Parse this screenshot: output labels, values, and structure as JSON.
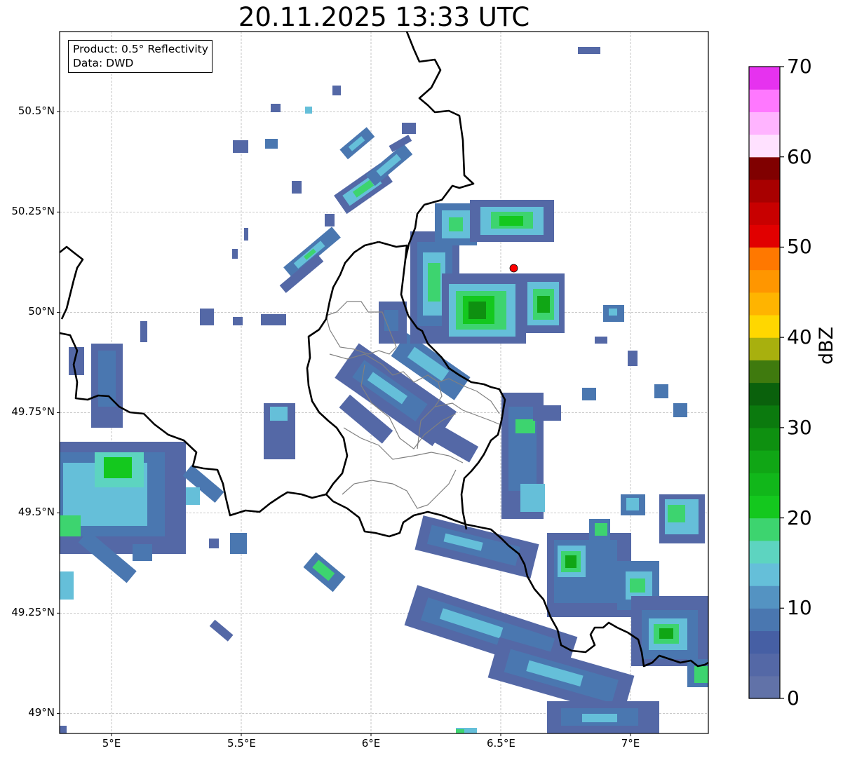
{
  "title": "20.11.2025 13:33 UTC",
  "info": {
    "product_label": "Product:",
    "product_value": "0.5° Reflectivity",
    "data_label": "Data:",
    "data_value": "DWD"
  },
  "map": {
    "lon_range": [
      4.8,
      7.3
    ],
    "lat_range": [
      48.95,
      50.7
    ],
    "lon_ticks": [
      5.0,
      5.5,
      6.0,
      6.5,
      7.0
    ],
    "lat_ticks": [
      49.0,
      49.25,
      49.5,
      49.75,
      50.0,
      50.25,
      50.5
    ],
    "lon_tick_labels": [
      "5°E",
      "5.5°E",
      "6°E",
      "6.5°E",
      "7°E"
    ],
    "lat_tick_labels": [
      "49°N",
      "49.25°N",
      "49.5°N",
      "49.75°N",
      "50°N",
      "50.25°N",
      "50.5°N"
    ],
    "gridlines": true,
    "radar_site": {
      "lon": 6.55,
      "lat": 50.11,
      "color": "#ff0000"
    }
  },
  "colorbar": {
    "label": "dBZ",
    "min": 0,
    "max": 70,
    "ticks": [
      0,
      10,
      20,
      30,
      40,
      50,
      60,
      70
    ],
    "tick_labels": [
      "0",
      "10",
      "20",
      "30",
      "40",
      "50",
      "60",
      "70"
    ],
    "step": 2.5,
    "colors": [
      "#6172a8",
      "#5468a6",
      "#465fa4",
      "#4a77b0",
      "#5493c2",
      "#65bfd9",
      "#5dd4c0",
      "#3dd46f",
      "#14c81e",
      "#11b71a",
      "#10a615",
      "#0e9010",
      "#0b7a0e",
      "#0a610c",
      "#3f7a0e",
      "#a8b00e",
      "#ffd700",
      "#ffb400",
      "#ff9600",
      "#ff7800",
      "#e10000",
      "#c80000",
      "#a80000",
      "#800000",
      "#ffe1ff",
      "#ffb4ff",
      "#ff78ff",
      "#e632ef"
    ]
  }
}
